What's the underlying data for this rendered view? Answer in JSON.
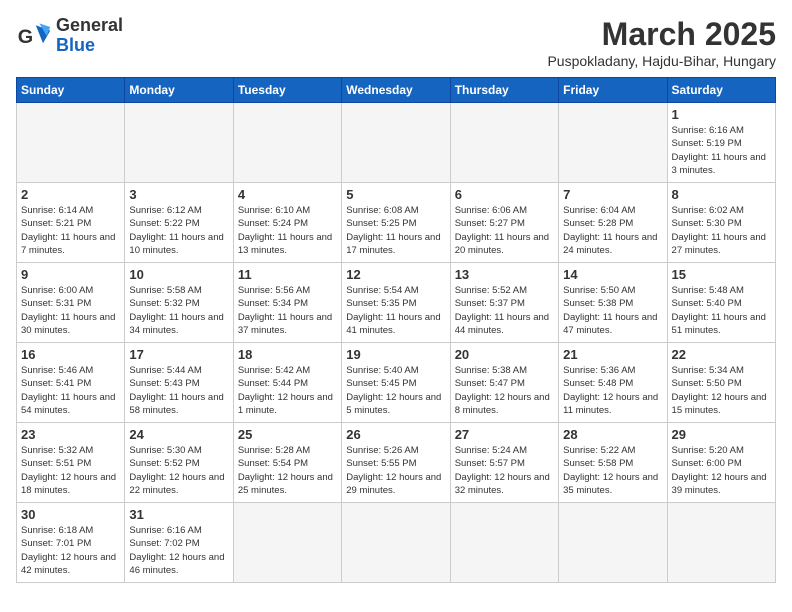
{
  "header": {
    "logo_general": "General",
    "logo_blue": "Blue",
    "month": "March 2025",
    "location": "Puspokladany, Hajdu-Bihar, Hungary"
  },
  "days_of_week": [
    "Sunday",
    "Monday",
    "Tuesday",
    "Wednesday",
    "Thursday",
    "Friday",
    "Saturday"
  ],
  "weeks": [
    [
      {
        "day": "",
        "info": ""
      },
      {
        "day": "",
        "info": ""
      },
      {
        "day": "",
        "info": ""
      },
      {
        "day": "",
        "info": ""
      },
      {
        "day": "",
        "info": ""
      },
      {
        "day": "",
        "info": ""
      },
      {
        "day": "1",
        "info": "Sunrise: 6:16 AM\nSunset: 5:19 PM\nDaylight: 11 hours\nand 3 minutes."
      }
    ],
    [
      {
        "day": "2",
        "info": "Sunrise: 6:14 AM\nSunset: 5:21 PM\nDaylight: 11 hours\nand 7 minutes."
      },
      {
        "day": "3",
        "info": "Sunrise: 6:12 AM\nSunset: 5:22 PM\nDaylight: 11 hours\nand 10 minutes."
      },
      {
        "day": "4",
        "info": "Sunrise: 6:10 AM\nSunset: 5:24 PM\nDaylight: 11 hours\nand 13 minutes."
      },
      {
        "day": "5",
        "info": "Sunrise: 6:08 AM\nSunset: 5:25 PM\nDaylight: 11 hours\nand 17 minutes."
      },
      {
        "day": "6",
        "info": "Sunrise: 6:06 AM\nSunset: 5:27 PM\nDaylight: 11 hours\nand 20 minutes."
      },
      {
        "day": "7",
        "info": "Sunrise: 6:04 AM\nSunset: 5:28 PM\nDaylight: 11 hours\nand 24 minutes."
      },
      {
        "day": "8",
        "info": "Sunrise: 6:02 AM\nSunset: 5:30 PM\nDaylight: 11 hours\nand 27 minutes."
      }
    ],
    [
      {
        "day": "9",
        "info": "Sunrise: 6:00 AM\nSunset: 5:31 PM\nDaylight: 11 hours\nand 30 minutes."
      },
      {
        "day": "10",
        "info": "Sunrise: 5:58 AM\nSunset: 5:32 PM\nDaylight: 11 hours\nand 34 minutes."
      },
      {
        "day": "11",
        "info": "Sunrise: 5:56 AM\nSunset: 5:34 PM\nDaylight: 11 hours\nand 37 minutes."
      },
      {
        "day": "12",
        "info": "Sunrise: 5:54 AM\nSunset: 5:35 PM\nDaylight: 11 hours\nand 41 minutes."
      },
      {
        "day": "13",
        "info": "Sunrise: 5:52 AM\nSunset: 5:37 PM\nDaylight: 11 hours\nand 44 minutes."
      },
      {
        "day": "14",
        "info": "Sunrise: 5:50 AM\nSunset: 5:38 PM\nDaylight: 11 hours\nand 47 minutes."
      },
      {
        "day": "15",
        "info": "Sunrise: 5:48 AM\nSunset: 5:40 PM\nDaylight: 11 hours\nand 51 minutes."
      }
    ],
    [
      {
        "day": "16",
        "info": "Sunrise: 5:46 AM\nSunset: 5:41 PM\nDaylight: 11 hours\nand 54 minutes."
      },
      {
        "day": "17",
        "info": "Sunrise: 5:44 AM\nSunset: 5:43 PM\nDaylight: 11 hours\nand 58 minutes."
      },
      {
        "day": "18",
        "info": "Sunrise: 5:42 AM\nSunset: 5:44 PM\nDaylight: 12 hours\nand 1 minute."
      },
      {
        "day": "19",
        "info": "Sunrise: 5:40 AM\nSunset: 5:45 PM\nDaylight: 12 hours\nand 5 minutes."
      },
      {
        "day": "20",
        "info": "Sunrise: 5:38 AM\nSunset: 5:47 PM\nDaylight: 12 hours\nand 8 minutes."
      },
      {
        "day": "21",
        "info": "Sunrise: 5:36 AM\nSunset: 5:48 PM\nDaylight: 12 hours\nand 11 minutes."
      },
      {
        "day": "22",
        "info": "Sunrise: 5:34 AM\nSunset: 5:50 PM\nDaylight: 12 hours\nand 15 minutes."
      }
    ],
    [
      {
        "day": "23",
        "info": "Sunrise: 5:32 AM\nSunset: 5:51 PM\nDaylight: 12 hours\nand 18 minutes."
      },
      {
        "day": "24",
        "info": "Sunrise: 5:30 AM\nSunset: 5:52 PM\nDaylight: 12 hours\nand 22 minutes."
      },
      {
        "day": "25",
        "info": "Sunrise: 5:28 AM\nSunset: 5:54 PM\nDaylight: 12 hours\nand 25 minutes."
      },
      {
        "day": "26",
        "info": "Sunrise: 5:26 AM\nSunset: 5:55 PM\nDaylight: 12 hours\nand 29 minutes."
      },
      {
        "day": "27",
        "info": "Sunrise: 5:24 AM\nSunset: 5:57 PM\nDaylight: 12 hours\nand 32 minutes."
      },
      {
        "day": "28",
        "info": "Sunrise: 5:22 AM\nSunset: 5:58 PM\nDaylight: 12 hours\nand 35 minutes."
      },
      {
        "day": "29",
        "info": "Sunrise: 5:20 AM\nSunset: 6:00 PM\nDaylight: 12 hours\nand 39 minutes."
      }
    ],
    [
      {
        "day": "30",
        "info": "Sunrise: 6:18 AM\nSunset: 7:01 PM\nDaylight: 12 hours\nand 42 minutes."
      },
      {
        "day": "31",
        "info": "Sunrise: 6:16 AM\nSunset: 7:02 PM\nDaylight: 12 hours\nand 46 minutes."
      },
      {
        "day": "",
        "info": ""
      },
      {
        "day": "",
        "info": ""
      },
      {
        "day": "",
        "info": ""
      },
      {
        "day": "",
        "info": ""
      },
      {
        "day": "",
        "info": ""
      }
    ]
  ]
}
